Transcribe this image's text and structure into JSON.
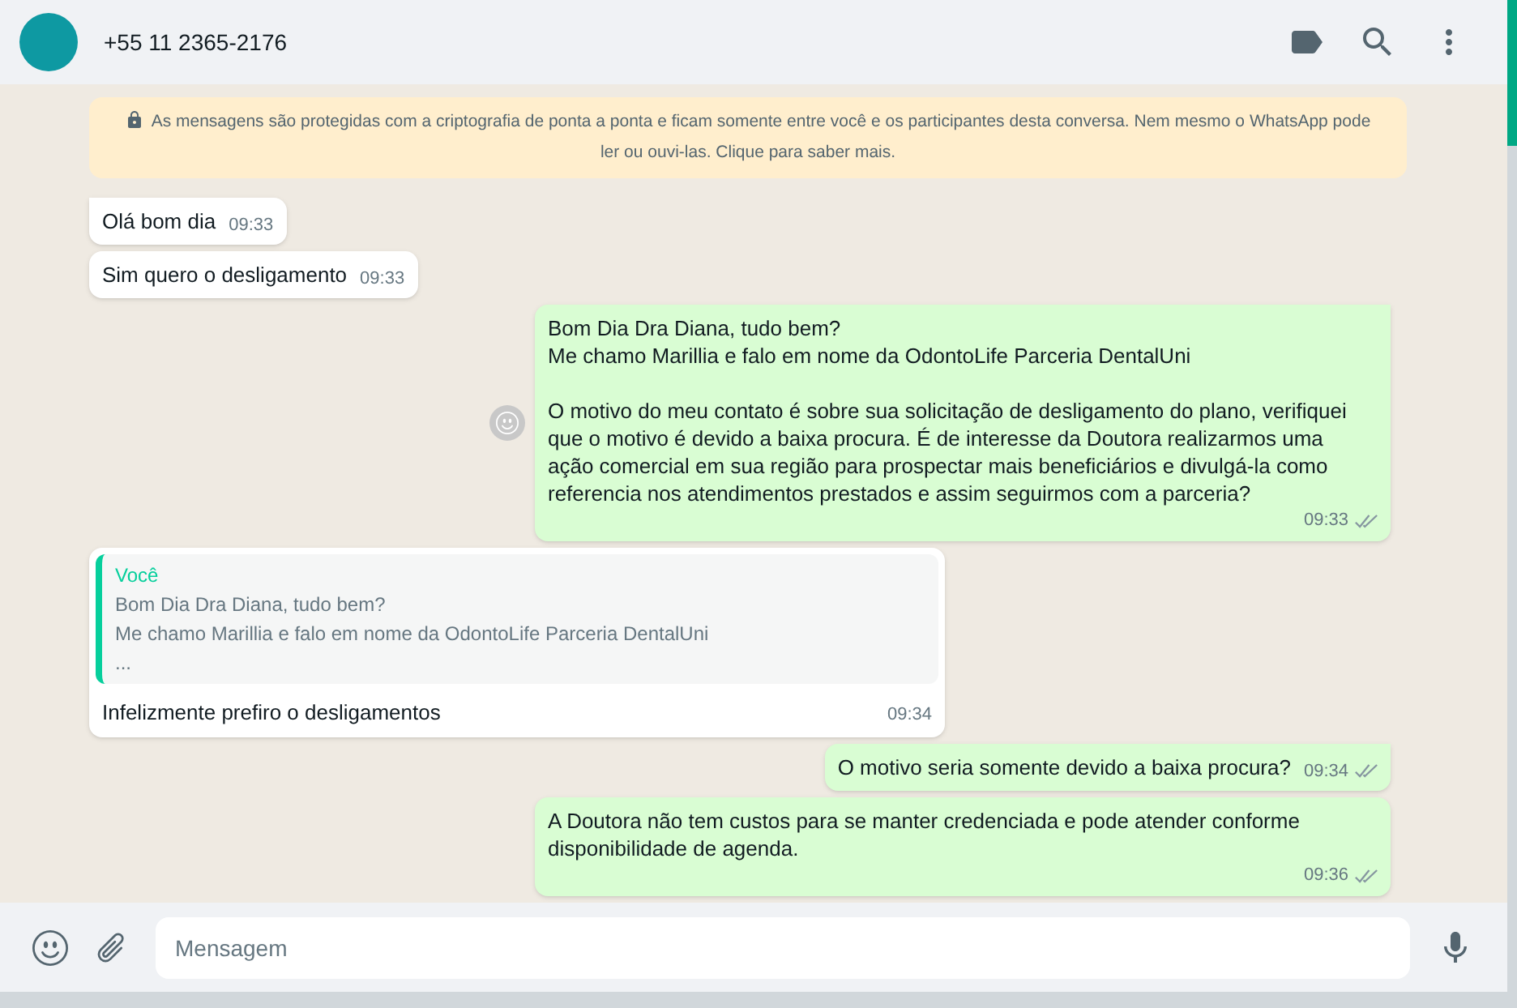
{
  "header": {
    "contact": "+55 11 2365-2176"
  },
  "encryption_notice": "As mensagens são protegidas com a criptografia de ponta a ponta e ficam somente entre você e os participantes desta conversa. Nem mesmo o WhatsApp pode ler ou ouvi-las. Clique para saber mais.",
  "messages": [
    {
      "kind": "incoming",
      "text": "Olá bom dia",
      "time": "09:33",
      "tail": true
    },
    {
      "kind": "incoming",
      "text": "Sim quero o desligamento",
      "time": "09:33",
      "tail": false
    },
    {
      "kind": "outgoing",
      "text": "Bom Dia Dra Diana, tudo bem?\nMe chamo Marillia e falo em nome da OdontoLife Parceria DentalUni\n\nO motivo do meu contato é sobre sua solicitação de desligamento do plano, verifiquei que o motivo é devido a baixa procura. É de interesse da Doutora realizarmos uma ação comercial em sua região para prospectar mais beneficiários e divulgá-la como referencia nos atendimentos prestados e assim seguirmos com a parceria?",
      "time": "09:33",
      "tail": true,
      "reaction_button": true
    },
    {
      "kind": "incoming",
      "quote": {
        "author": "Você",
        "text": "Bom Dia Dra Diana, tudo bem?\nMe chamo Marillia e falo em nome da OdontoLife Parceria DentalUni\n..."
      },
      "text": "Infelizmente prefiro o desligamentos",
      "time": "09:34"
    },
    {
      "kind": "outgoing",
      "text": "O motivo seria somente devido a baixa procura?",
      "time": "09:34",
      "tail": true
    },
    {
      "kind": "outgoing",
      "text": "A Doutora não tem custos para se manter credenciada e pode atender conforme disponibilidade de agenda.",
      "time": "09:36",
      "tail": false
    }
  ],
  "composer": {
    "placeholder": "Mensagem"
  }
}
